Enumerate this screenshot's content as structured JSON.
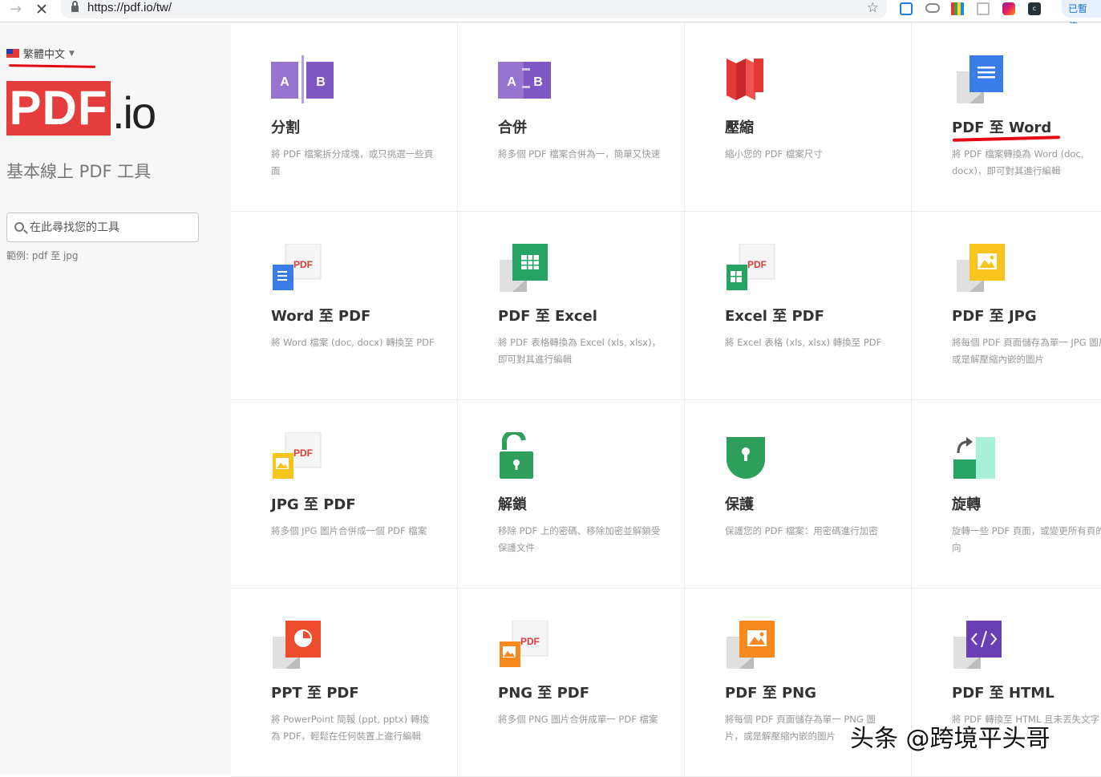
{
  "browser": {
    "url": "https://pdf.io/tw/",
    "paused_label": "已暫停"
  },
  "sidebar": {
    "language": "繁體中文",
    "logo_box": "PDF",
    "logo_suffix": ".io",
    "tagline": "基本線上 PDF 工具",
    "search_placeholder": "在此尋找您的工具",
    "example": "範例: pdf 至 jpg"
  },
  "tools": [
    {
      "title": "分割",
      "desc": "將 PDF 檔案拆分成塊，或只挑選一些頁面",
      "icon": "split-icon"
    },
    {
      "title": "合併",
      "desc": "將多個 PDF 檔案合併為一，簡單又快速",
      "icon": "merge-icon"
    },
    {
      "title": "壓縮",
      "desc": "縮小您的 PDF 檔案尺寸",
      "icon": "compress-icon"
    },
    {
      "title": "PDF 至 Word",
      "desc": "將 PDF 檔案轉換為 Word (doc, docx)，即可對其進行編輯",
      "icon": "pdf-to-word-icon"
    },
    {
      "title": "Word 至 PDF",
      "desc": "將 Word 檔案 (doc, docx) 轉換至 PDF",
      "icon": "word-to-pdf-icon"
    },
    {
      "title": "PDF 至 Excel",
      "desc": "將 PDF 表格轉換為 Excel (xls, xlsx)，即可對其進行編輯",
      "icon": "pdf-to-excel-icon"
    },
    {
      "title": "Excel 至 PDF",
      "desc": "將 Excel 表格 (xls, xlsx) 轉換至 PDF",
      "icon": "excel-to-pdf-icon"
    },
    {
      "title": "PDF 至 JPG",
      "desc": "將每個 PDF 頁面儲存為單一 JPG 圖片，或是解壓縮內嵌的圖片",
      "icon": "pdf-to-jpg-icon"
    },
    {
      "title": "JPG 至 PDF",
      "desc": "將多個 JPG 圖片合併成一個 PDF 檔案",
      "icon": "jpg-to-pdf-icon"
    },
    {
      "title": "解鎖",
      "desc": "移除 PDF 上的密碼、移除加密並解鎖受保護文件",
      "icon": "unlock-icon"
    },
    {
      "title": "保護",
      "desc": "保護您的 PDF 檔案：用密碼進行加密",
      "icon": "protect-icon"
    },
    {
      "title": "旋轉",
      "desc": "旋轉一些 PDF 頁面，或變更所有頁的方向",
      "icon": "rotate-icon"
    },
    {
      "title": "PPT 至 PDF",
      "desc": "將 PowerPoint 簡報 (ppt, pptx) 轉換為 PDF，輕鬆在任何裝置上進行編輯",
      "icon": "ppt-to-pdf-icon"
    },
    {
      "title": "PNG 至 PDF",
      "desc": "將多個 PNG 圖片合併成單一 PDF 檔案",
      "icon": "png-to-pdf-icon"
    },
    {
      "title": "PDF 至 PNG",
      "desc": "將每個 PDF 頁面儲存為單一 PNG 圖片，或是解壓縮內嵌的圖片",
      "icon": "pdf-to-png-icon"
    },
    {
      "title": "PDF 至 HTML",
      "desc": "將 PDF 轉換至 HTML 且未丟失文字",
      "icon": "pdf-to-html-icon"
    }
  ],
  "watermark": "头条 @跨境平头哥",
  "colors": {
    "brand_red": "#e53d3b",
    "split_purple": "#7e57c2",
    "word_blue": "#3b7de8",
    "excel_green": "#27a463",
    "jpg_yellow": "#f7c51e",
    "lock_green": "#2e9e5b",
    "ppt_orange": "#ee4d2d",
    "png_orange": "#f7891f",
    "html_purple": "#6a3fb5"
  }
}
